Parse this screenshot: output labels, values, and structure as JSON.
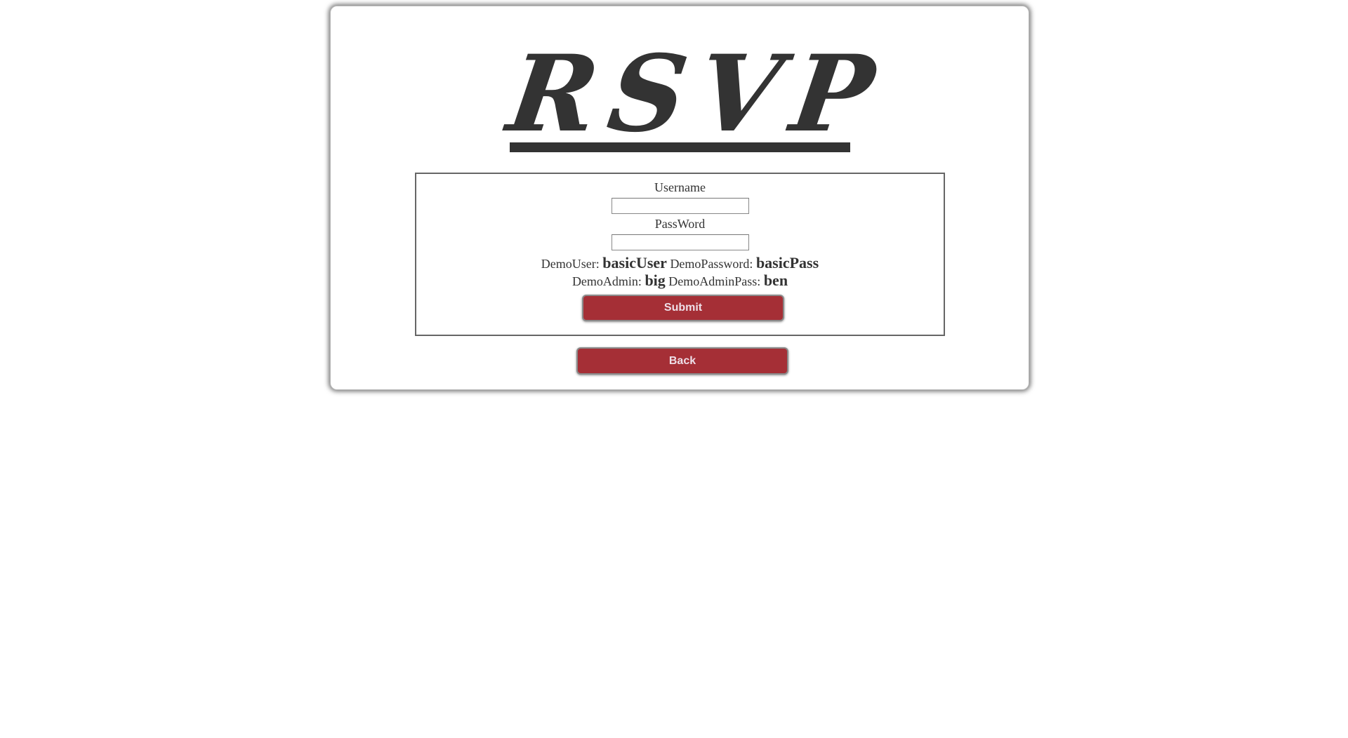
{
  "page": {
    "title": "RSVP"
  },
  "login_form": {
    "username_label": "Username",
    "username_value": "",
    "password_label": "PassWord",
    "password_value": "",
    "demo_user_label": "DemoUser:",
    "demo_user_value": "basicUser",
    "demo_password_label": "DemoPassword:",
    "demo_password_value": "basicPass",
    "demo_admin_label": "DemoAdmin:",
    "demo_admin_value": "big",
    "demo_admin_pass_label": "DemoAdminPass:",
    "demo_admin_pass_value": "ben",
    "submit_label": "Submit"
  },
  "navigation": {
    "back_label": "Back"
  },
  "colors": {
    "button_background": "#a52f36",
    "button_text": "#eedfe8",
    "title_text": "#333333",
    "page_background": "#ffffff"
  }
}
